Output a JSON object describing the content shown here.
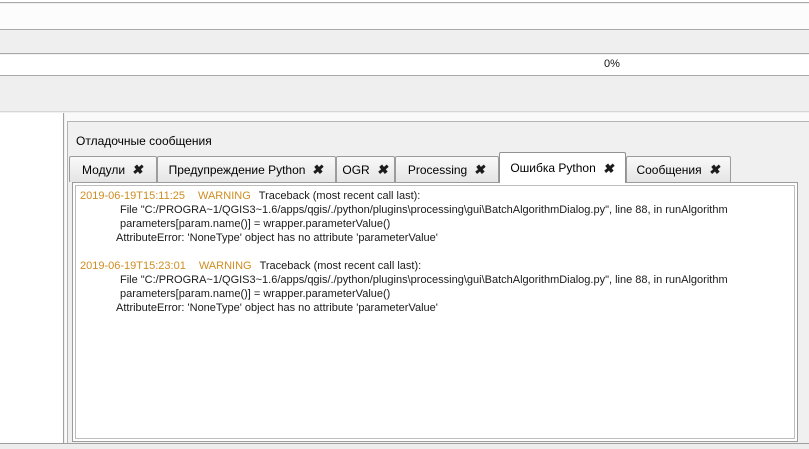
{
  "progress": {
    "value_label": "0%"
  },
  "panel": {
    "title": "Отладочные сообщения",
    "close_icon": "✖",
    "colors": {
      "warning": "#cf8d21"
    },
    "tabs": [
      {
        "label": "Модули",
        "active": false
      },
      {
        "label": "Предупреждение Python",
        "active": false
      },
      {
        "label": "OGR",
        "active": false
      },
      {
        "label": "Processing",
        "active": false
      },
      {
        "label": "Ошибка Python",
        "active": true
      },
      {
        "label": "Сообщения",
        "active": false
      }
    ],
    "log_entries": [
      {
        "timestamp": "2019-06-19T15:11:25",
        "level": "WARNING",
        "message": "Traceback (most recent call last):",
        "lines": [
          "File \"C:/PROGRA~1/QGIS3~1.6/apps/qgis/./python/plugins\\processing\\gui\\BatchAlgorithmDialog.py\", line 88, in runAlgorithm",
          "parameters[param.name()] = wrapper.parameterValue()",
          "AttributeError: 'NoneType' object has no attribute 'parameterValue'"
        ]
      },
      {
        "timestamp": "2019-06-19T15:23:01",
        "level": "WARNING",
        "message": "Traceback (most recent call last):",
        "lines": [
          "File \"C:/PROGRA~1/QGIS3~1.6/apps/qgis/./python/plugins\\processing\\gui\\BatchAlgorithmDialog.py\", line 88, in runAlgorithm",
          "parameters[param.name()] = wrapper.parameterValue()",
          "AttributeError: 'NoneType' object has no attribute 'parameterValue'"
        ]
      }
    ]
  }
}
